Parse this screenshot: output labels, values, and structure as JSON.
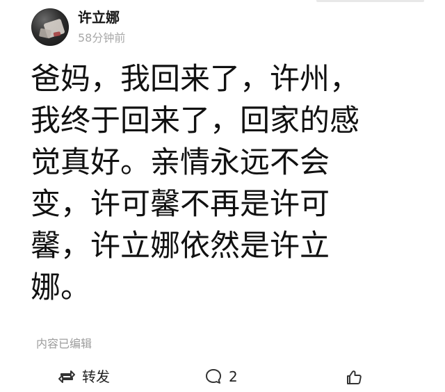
{
  "post": {
    "author": "许立娜",
    "timestamp": "58分钟前",
    "lines": [
      "爸妈，我回来了，许州，",
      "我终于回来了，回家的感",
      "觉真好。亲情永远不会",
      "变，许可馨不再是许可",
      "馨，许立娜依然是许立",
      "娜。"
    ],
    "edited_label": "内容已编辑"
  },
  "actions": {
    "repost_label": "转发",
    "comment_count": "2"
  },
  "icons": {
    "avatar": "avatar",
    "repost": "repost-icon",
    "comment": "comment-bubble-icon",
    "like": "thumbs-up-icon"
  }
}
